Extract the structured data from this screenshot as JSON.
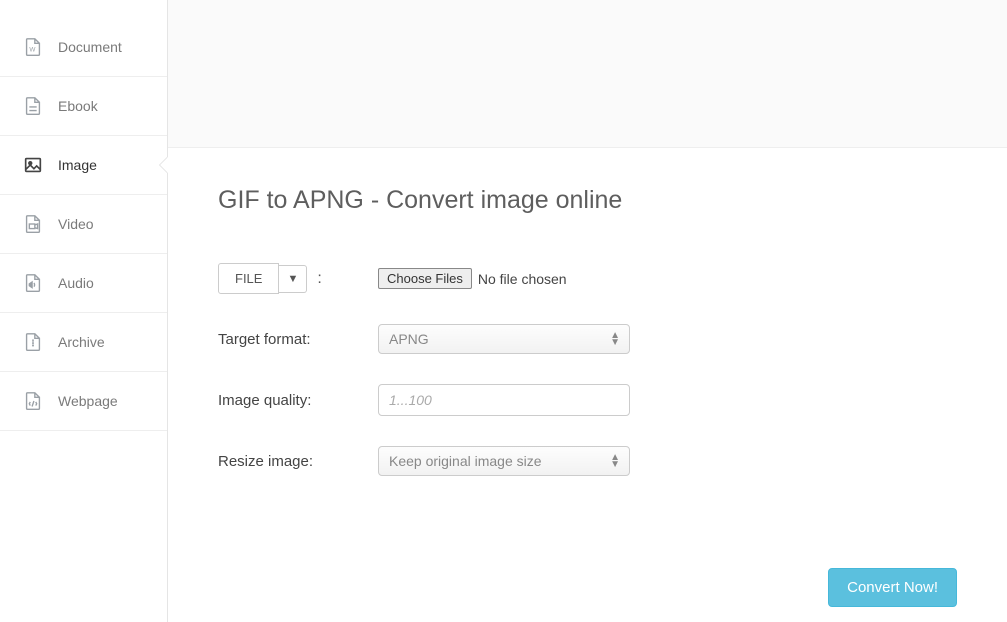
{
  "sidebar": {
    "items": [
      {
        "label": "Document",
        "icon": "document-icon"
      },
      {
        "label": "Ebook",
        "icon": "ebook-icon"
      },
      {
        "label": "Image",
        "icon": "image-icon",
        "active": true
      },
      {
        "label": "Video",
        "icon": "video-icon"
      },
      {
        "label": "Audio",
        "icon": "audio-icon"
      },
      {
        "label": "Archive",
        "icon": "archive-icon"
      },
      {
        "label": "Webpage",
        "icon": "webpage-icon"
      }
    ]
  },
  "main": {
    "title": "GIF to APNG - Convert image online",
    "file_source": {
      "button_label": "FILE",
      "choose_label": "Choose Files",
      "status_text": "No file chosen"
    },
    "target_format": {
      "label": "Target format:",
      "value": "APNG"
    },
    "image_quality": {
      "label": "Image quality:",
      "placeholder": "1...100",
      "value": ""
    },
    "resize": {
      "label": "Resize image:",
      "value": "Keep original image size"
    },
    "convert_button": "Convert Now!"
  }
}
